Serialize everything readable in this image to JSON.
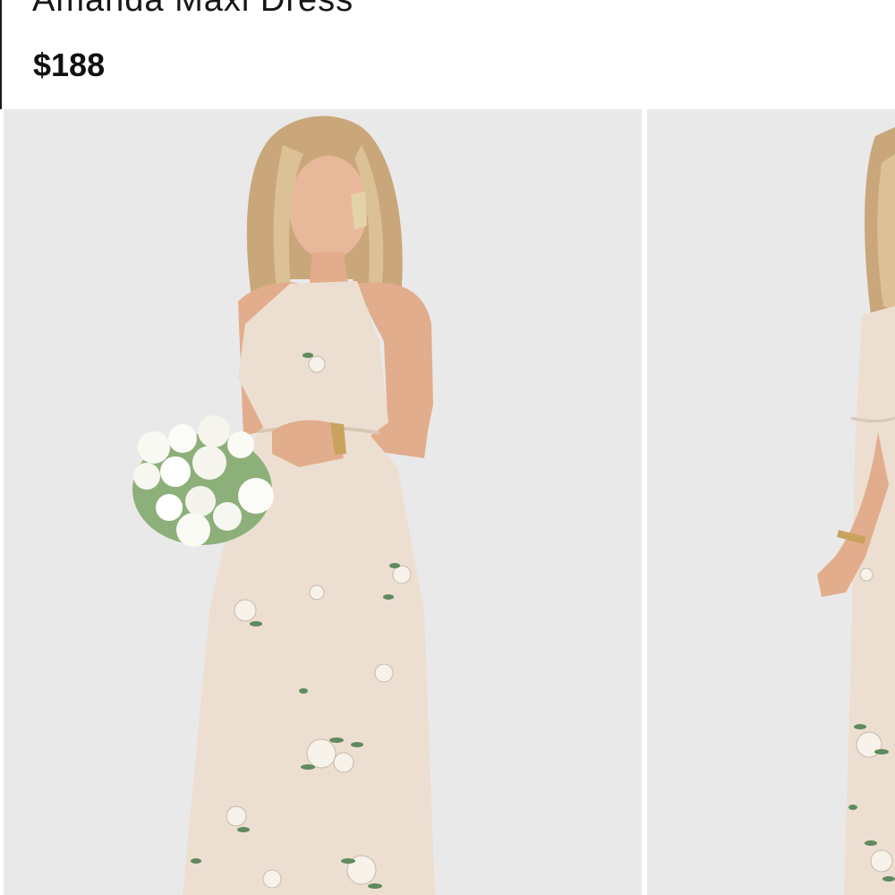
{
  "product": {
    "title": "Amanda Maxi Dress",
    "price": "$188"
  },
  "gallery": {
    "images": [
      {
        "name": "product-photo-front"
      },
      {
        "name": "product-photo-side"
      }
    ]
  },
  "colors": {
    "background": "#ffffff",
    "photo_backdrop": "#eae9e9",
    "dress": "#ecdfd2",
    "text": "#111111"
  }
}
